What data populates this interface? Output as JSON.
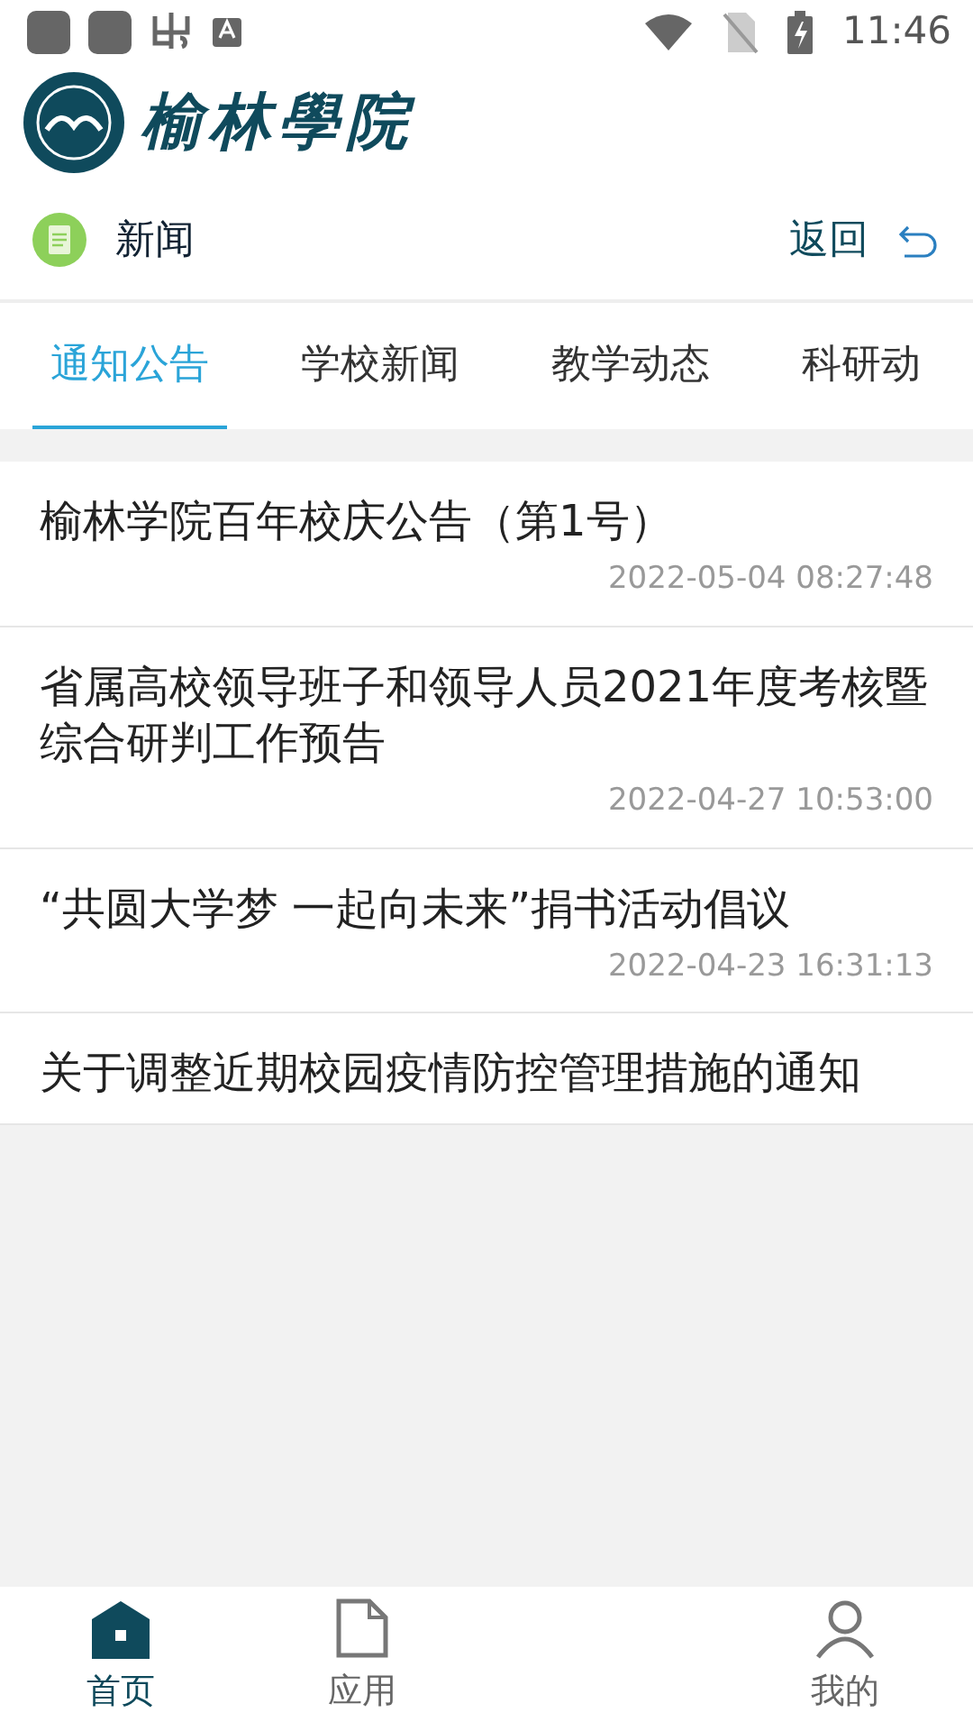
{
  "status_bar": {
    "time": "11:46"
  },
  "header": {
    "logo_text": "榆林學院"
  },
  "section": {
    "title": "新闻",
    "back": "返回"
  },
  "tabs": [
    {
      "label": "通知公告",
      "selected": true
    },
    {
      "label": "学校新闻",
      "selected": false
    },
    {
      "label": "教学动态",
      "selected": false
    },
    {
      "label": "科研动",
      "selected": false
    }
  ],
  "news": [
    {
      "title": "榆林学院百年校庆公告（第1号）",
      "time": "2022-05-04 08:27:48"
    },
    {
      "title": "省属高校领导班子和领导人员2021年度考核暨综合研判工作预告",
      "time": "2022-04-27 10:53:00"
    },
    {
      "title": "“共圆大学梦 一起向未来”捐书活动倡议",
      "time": "2022-04-23 16:31:13"
    },
    {
      "title": "关于调整近期校园疫情防控管理措施的通知"
    }
  ],
  "bottom_nav": [
    {
      "label": "首页",
      "kind": "home",
      "selected": true
    },
    {
      "label": "应用",
      "kind": "apps",
      "selected": false
    },
    {
      "kind": "gap"
    },
    {
      "label": "我的",
      "kind": "me",
      "selected": false
    }
  ]
}
